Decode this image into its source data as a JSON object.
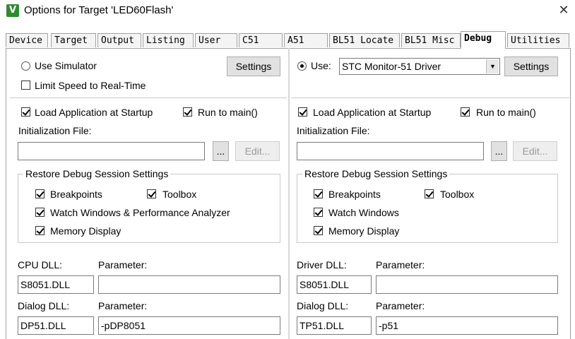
{
  "window": {
    "title": "Options for Target 'LED60Flash'",
    "icon": "uvision-icon",
    "close_glyph": "✕"
  },
  "tabs": [
    {
      "label": "Device"
    },
    {
      "label": "Target"
    },
    {
      "label": "Output"
    },
    {
      "label": "Listing"
    },
    {
      "label": "User"
    },
    {
      "label": "C51"
    },
    {
      "label": "A51"
    },
    {
      "label": "BL51 Locate"
    },
    {
      "label": "BL51 Misc"
    },
    {
      "label": "Debug",
      "active": true
    },
    {
      "label": "Utilities"
    }
  ],
  "left": {
    "use_simulator_label": "Use Simulator",
    "use_simulator_selected": false,
    "settings_label": "Settings",
    "limit_speed_label": "Limit Speed to Real-Time",
    "limit_speed_checked": false,
    "load_app_label": "Load Application at Startup",
    "run_to_main_label": "Run to main()",
    "init_file_label": "Initialization File:",
    "init_file_value": "",
    "browse_label": "...",
    "edit_label": "Edit...",
    "restore_title": "Restore Debug Session Settings",
    "breakpoints_label": "Breakpoints",
    "toolbox_label": "Toolbox",
    "watch_label": "Watch Windows & Performance Analyzer",
    "memory_label": "Memory Display",
    "cpu_dll_label": "CPU DLL:",
    "cpu_param_label": "Parameter:",
    "cpu_dll_value": "S8051.DLL",
    "cpu_param_value": "",
    "dialog_dll_label": "Dialog DLL:",
    "dialog_param_label": "Parameter:",
    "dialog_dll_value": "DP51.DLL",
    "dialog_param_value": "-pDP8051"
  },
  "right": {
    "use_label": "Use:",
    "use_selected": true,
    "driver_value": "STC Monitor-51 Driver",
    "settings_label": "Settings",
    "load_app_label": "Load Application at Startup",
    "run_to_main_label": "Run to main()",
    "init_file_label": "Initialization File:",
    "init_file_value": "",
    "browse_label": "...",
    "edit_label": "Edit...",
    "restore_title": "Restore Debug Session Settings",
    "breakpoints_label": "Breakpoints",
    "toolbox_label": "Toolbox",
    "watch_label": "Watch Windows",
    "memory_label": "Memory Display",
    "driver_dll_label": "Driver DLL:",
    "driver_param_label": "Parameter:",
    "driver_dll_value": "S8051.DLL",
    "driver_param_value": "",
    "dialog_dll_label": "Dialog DLL:",
    "dialog_param_label": "Parameter:",
    "dialog_dll_value": "TP51.DLL",
    "dialog_param_value": "-p51"
  }
}
